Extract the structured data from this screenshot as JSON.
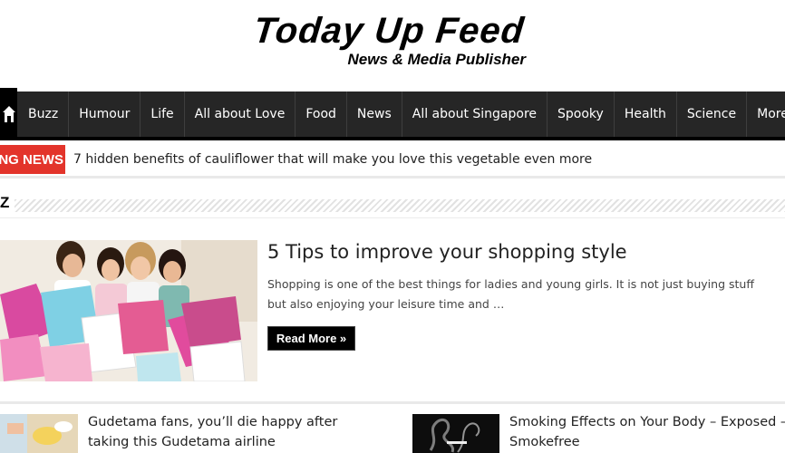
{
  "site": {
    "title": "Today Up Feed",
    "tagline": "News & Media Publisher"
  },
  "nav": {
    "home_icon": "home-icon",
    "items": [
      {
        "label": "Buzz"
      },
      {
        "label": "Humour"
      },
      {
        "label": "Life"
      },
      {
        "label": "All about Love"
      },
      {
        "label": "Food"
      },
      {
        "label": "News"
      },
      {
        "label": "All about Singapore"
      },
      {
        "label": "Spooky"
      },
      {
        "label": "Health"
      },
      {
        "label": "Science"
      },
      {
        "label": "More"
      }
    ]
  },
  "breaking": {
    "label": "KING NEWS",
    "headline": "7 hidden benefits of cauliflower that will make you love this vegetable even more"
  },
  "section": {
    "title": "Z"
  },
  "featured": {
    "title": "5 Tips to improve your shopping style",
    "excerpt": "Shopping is one of the best things for ladies and young girls. It is not just buying stuff but also enjoying your leisure time and …",
    "read_more": "Read More »"
  },
  "posts": [
    {
      "title": "Gudetama fans, you’ll die happy after taking this Gudetama airline"
    },
    {
      "title_line1": "Smoking Effects on Your Body – Exposed – Be",
      "title_line2": "Smokefree"
    }
  ],
  "colors": {
    "nav_bg": "#262626",
    "breaking_red": "#e3342b",
    "button_bg": "#000000"
  }
}
